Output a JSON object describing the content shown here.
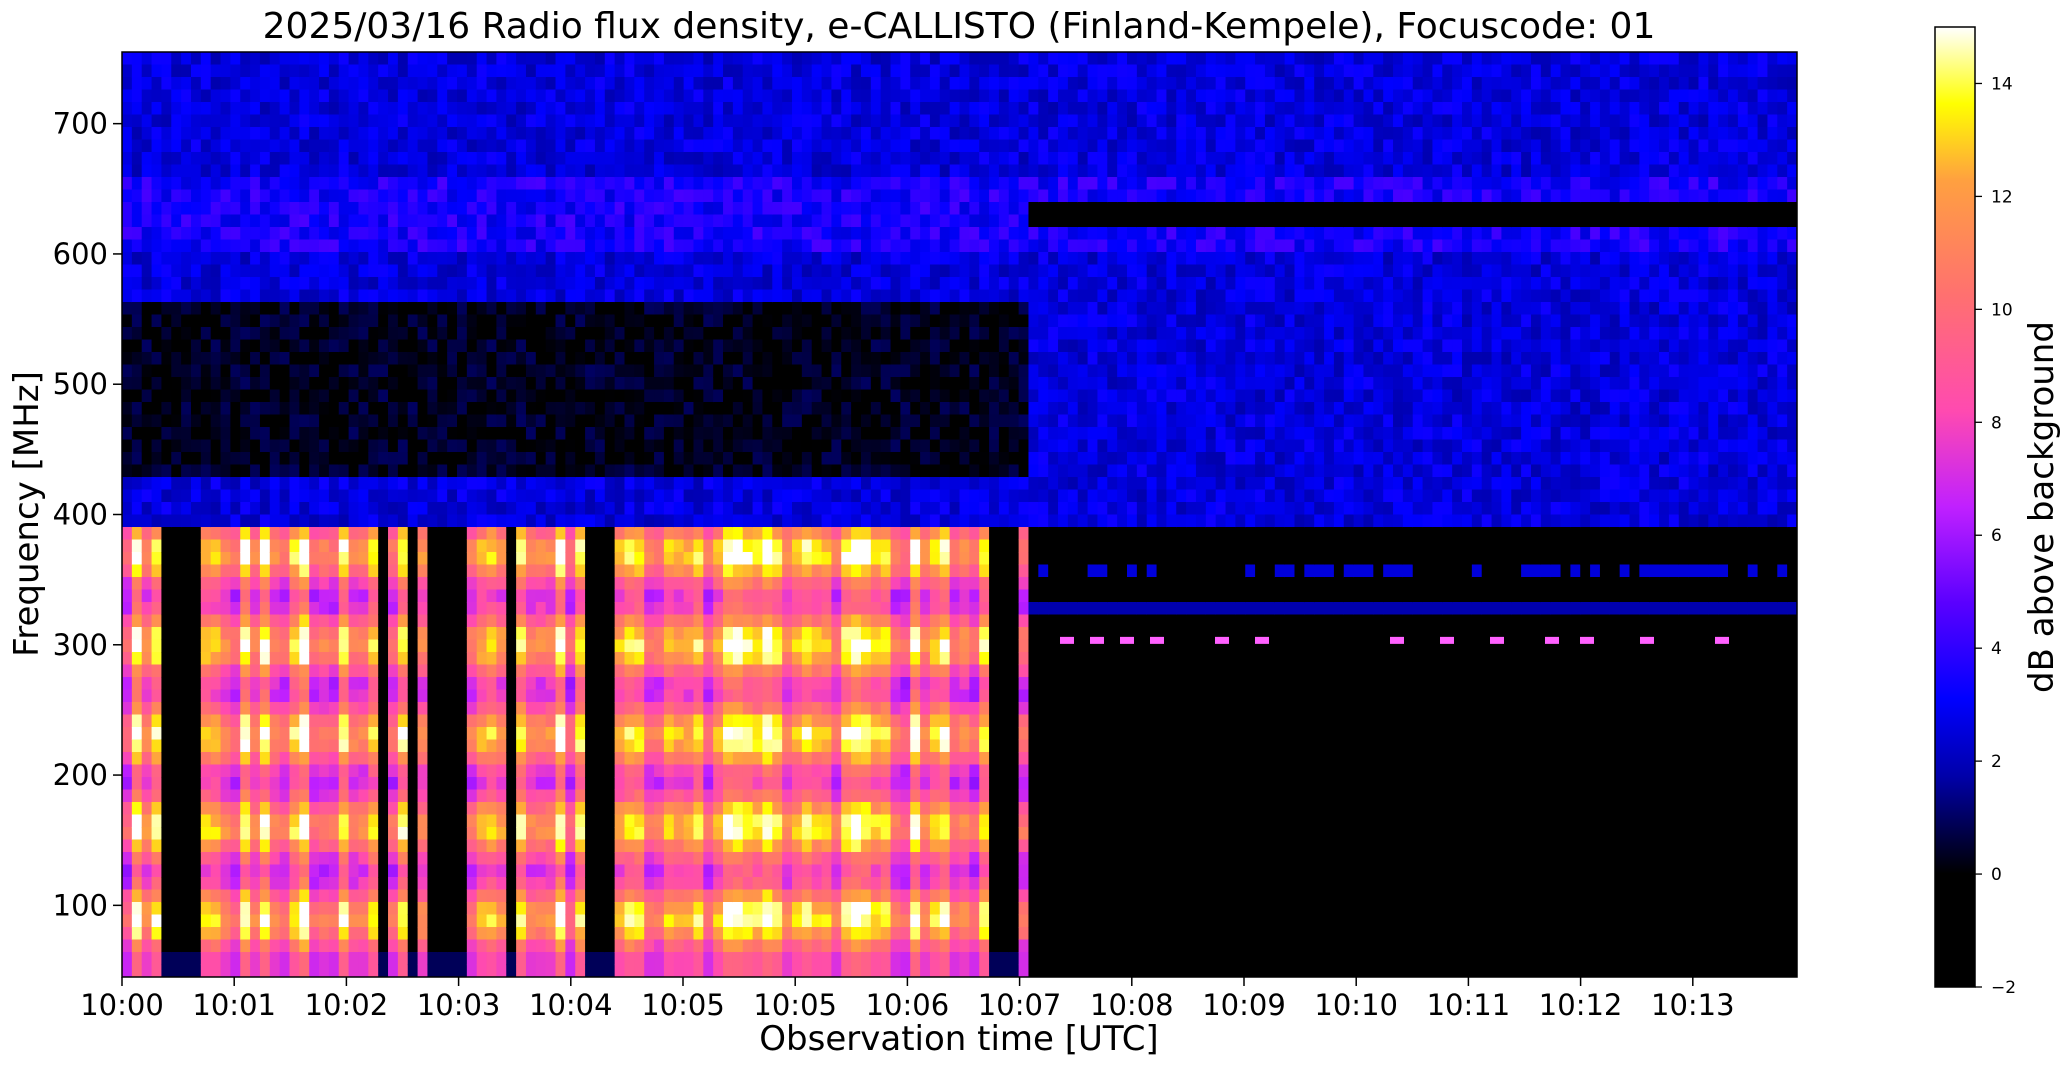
{
  "chart_data": {
    "type": "heatmap",
    "title": "2025/03/16  Radio flux density, e-CALLISTO (Finland-Kempele), Focuscode: 01",
    "xlabel": "Observation time [UTC]",
    "ylabel": "Frequency [MHz]",
    "x_ticks": [
      "10:00",
      "10:01",
      "10:02",
      "10:03",
      "10:04",
      "10:05",
      "10:05",
      "10:06",
      "10:07",
      "10:08",
      "10:09",
      "10:10",
      "10:11",
      "10:12",
      "10:13"
    ],
    "y_ticks": [
      100,
      200,
      300,
      400,
      500,
      600,
      700
    ],
    "ylim": [
      45,
      755
    ],
    "colorbar": {
      "label": "dB above background",
      "range": [
        -2,
        15
      ],
      "ticks": [
        -2,
        0,
        2,
        4,
        6,
        8,
        10,
        12,
        14
      ],
      "colormap": "gnuplot2"
    },
    "description_of_regions": {
      "burst_interval": [
        "10:00",
        "10:07"
      ],
      "burst_frequency_range_mhz": [
        45,
        390
      ],
      "burst_peak_db": 14,
      "quiet_interval": [
        "10:07",
        "10:14"
      ]
    }
  }
}
